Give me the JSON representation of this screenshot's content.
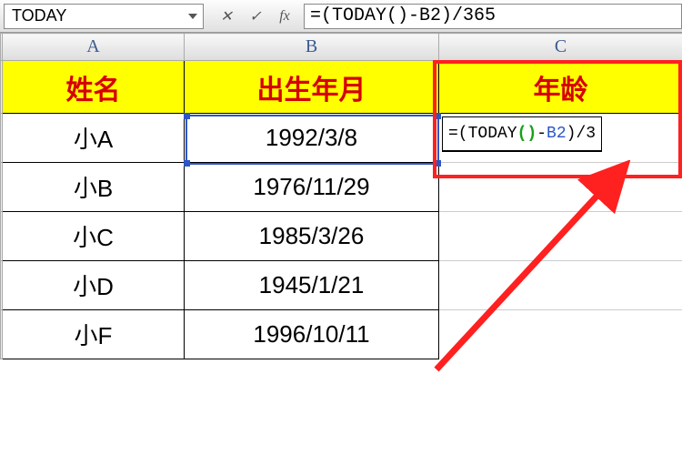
{
  "formula_bar": {
    "name_box_value": "TODAY",
    "cancel_symbol": "✕",
    "confirm_symbol": "✓",
    "fx_label": "fx",
    "formula_text": "=(TODAY()-B2)/365"
  },
  "columns": {
    "a": "A",
    "b": "B",
    "c": "C"
  },
  "headers": {
    "name": "姓名",
    "birth": "出生年月",
    "age": "年龄"
  },
  "rows": [
    {
      "name": "小A",
      "birth": "1992/3/8"
    },
    {
      "name": "小B",
      "birth": "1976/11/29"
    },
    {
      "name": "小C",
      "birth": "1985/3/26"
    },
    {
      "name": "小D",
      "birth": "1945/1/21"
    },
    {
      "name": "小F",
      "birth": "1996/10/11"
    }
  ],
  "editing": {
    "prefix": "=(TODAY",
    "paren": "()",
    "mid": "-",
    "ref": "B2",
    "suffix": ")/3"
  }
}
